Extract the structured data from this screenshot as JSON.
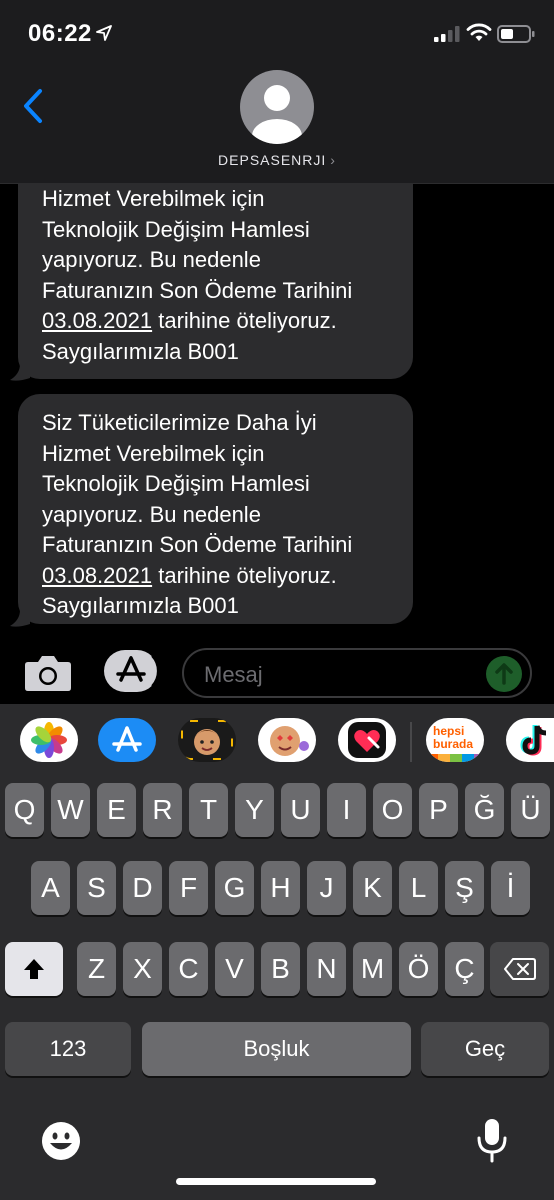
{
  "status_bar": {
    "time": "06:22"
  },
  "header": {
    "contact_name": "DEPSASENRJI",
    "chevron": "›"
  },
  "messages": [
    {
      "lines": [
        "Hizmet Verebilmek için",
        "Teknolojik Değişim Hamlesi",
        "yapıyoruz. Bu nedenle",
        "Faturanızın Son Ödeme Tarihini"
      ],
      "date_link": "03.08.2021",
      "after_link": " tarihine öteliyoruz.",
      "closing": "Saygılarımızla B001"
    },
    {
      "lines": [
        "Siz Tüketicilerimize Daha İyi",
        "Hizmet Verebilmek için",
        "Teknolojik Değişim Hamlesi",
        "yapıyoruz. Bu nedenle",
        "Faturanızın Son Ödeme Tarihini"
      ],
      "date_link": "03.08.2021",
      "after_link": " tarihine öteliyoruz.",
      "closing": "Saygılarımızla B001"
    }
  ],
  "compose": {
    "placeholder": "Mesaj"
  },
  "drawer_apps": [
    {
      "name": "photos-app-icon"
    },
    {
      "name": "app-store-app-icon"
    },
    {
      "name": "memoji-app-icon"
    },
    {
      "name": "animoji-stickers-app-icon"
    },
    {
      "name": "digital-touch-app-icon"
    },
    {
      "name": "hepsiburada-app-icon",
      "label_1": "hepsi",
      "label_2": "burada"
    },
    {
      "name": "tiktok-app-icon"
    }
  ],
  "keyboard": {
    "row1": [
      "Q",
      "W",
      "E",
      "R",
      "T",
      "Y",
      "U",
      "I",
      "O",
      "P",
      "Ğ",
      "Ü"
    ],
    "row2": [
      "A",
      "S",
      "D",
      "F",
      "G",
      "H",
      "J",
      "K",
      "L",
      "Ş",
      "İ"
    ],
    "row3": [
      "Z",
      "X",
      "C",
      "V",
      "B",
      "N",
      "M",
      "Ö",
      "Ç"
    ],
    "numbers_label": "123",
    "space_label": "Boşluk",
    "return_label": "Geç"
  },
  "colors": {
    "accent": "#0a84ff",
    "bubble": "#2c2c2e",
    "send_disabled": "#1e5e2a"
  }
}
